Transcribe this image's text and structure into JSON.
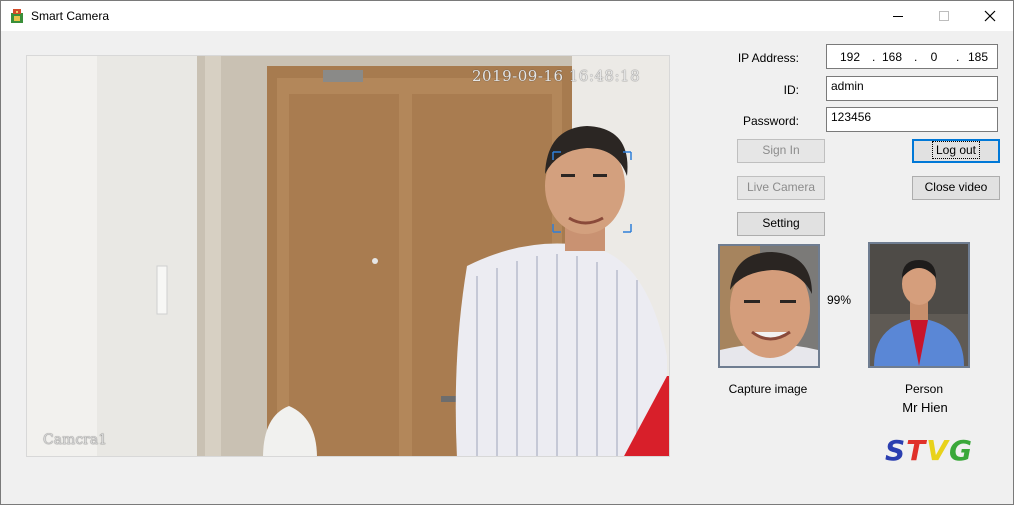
{
  "window": {
    "title": "Smart Camera",
    "close_glyph": "✕",
    "min_glyph": "—",
    "max_glyph": "☐"
  },
  "video": {
    "timestamp": "2019-09-16 16:48:18",
    "camera_label": "Camcra1",
    "ghost_tab": "Window Snip"
  },
  "form": {
    "ip_label": "IP Address:",
    "ip": [
      "192",
      "168",
      "0",
      "185"
    ],
    "id_label": "ID:",
    "id_value": "admin",
    "password_label": "Password:",
    "password_value": "123456"
  },
  "buttons": {
    "sign_in": "Sign In",
    "log_out": "Log out",
    "live_camera": "Live Camera",
    "close_video": "Close video",
    "setting": "Setting"
  },
  "recognition": {
    "match_percent": "99%",
    "capture_label": "Capture image",
    "person_label": "Person",
    "person_name": "Mr Hien"
  },
  "logo": {
    "letters": [
      "S",
      "T",
      "V",
      "G"
    ],
    "colors": [
      "#2b3fb0",
      "#e0312a",
      "#e8d21a",
      "#3aa83a"
    ]
  }
}
